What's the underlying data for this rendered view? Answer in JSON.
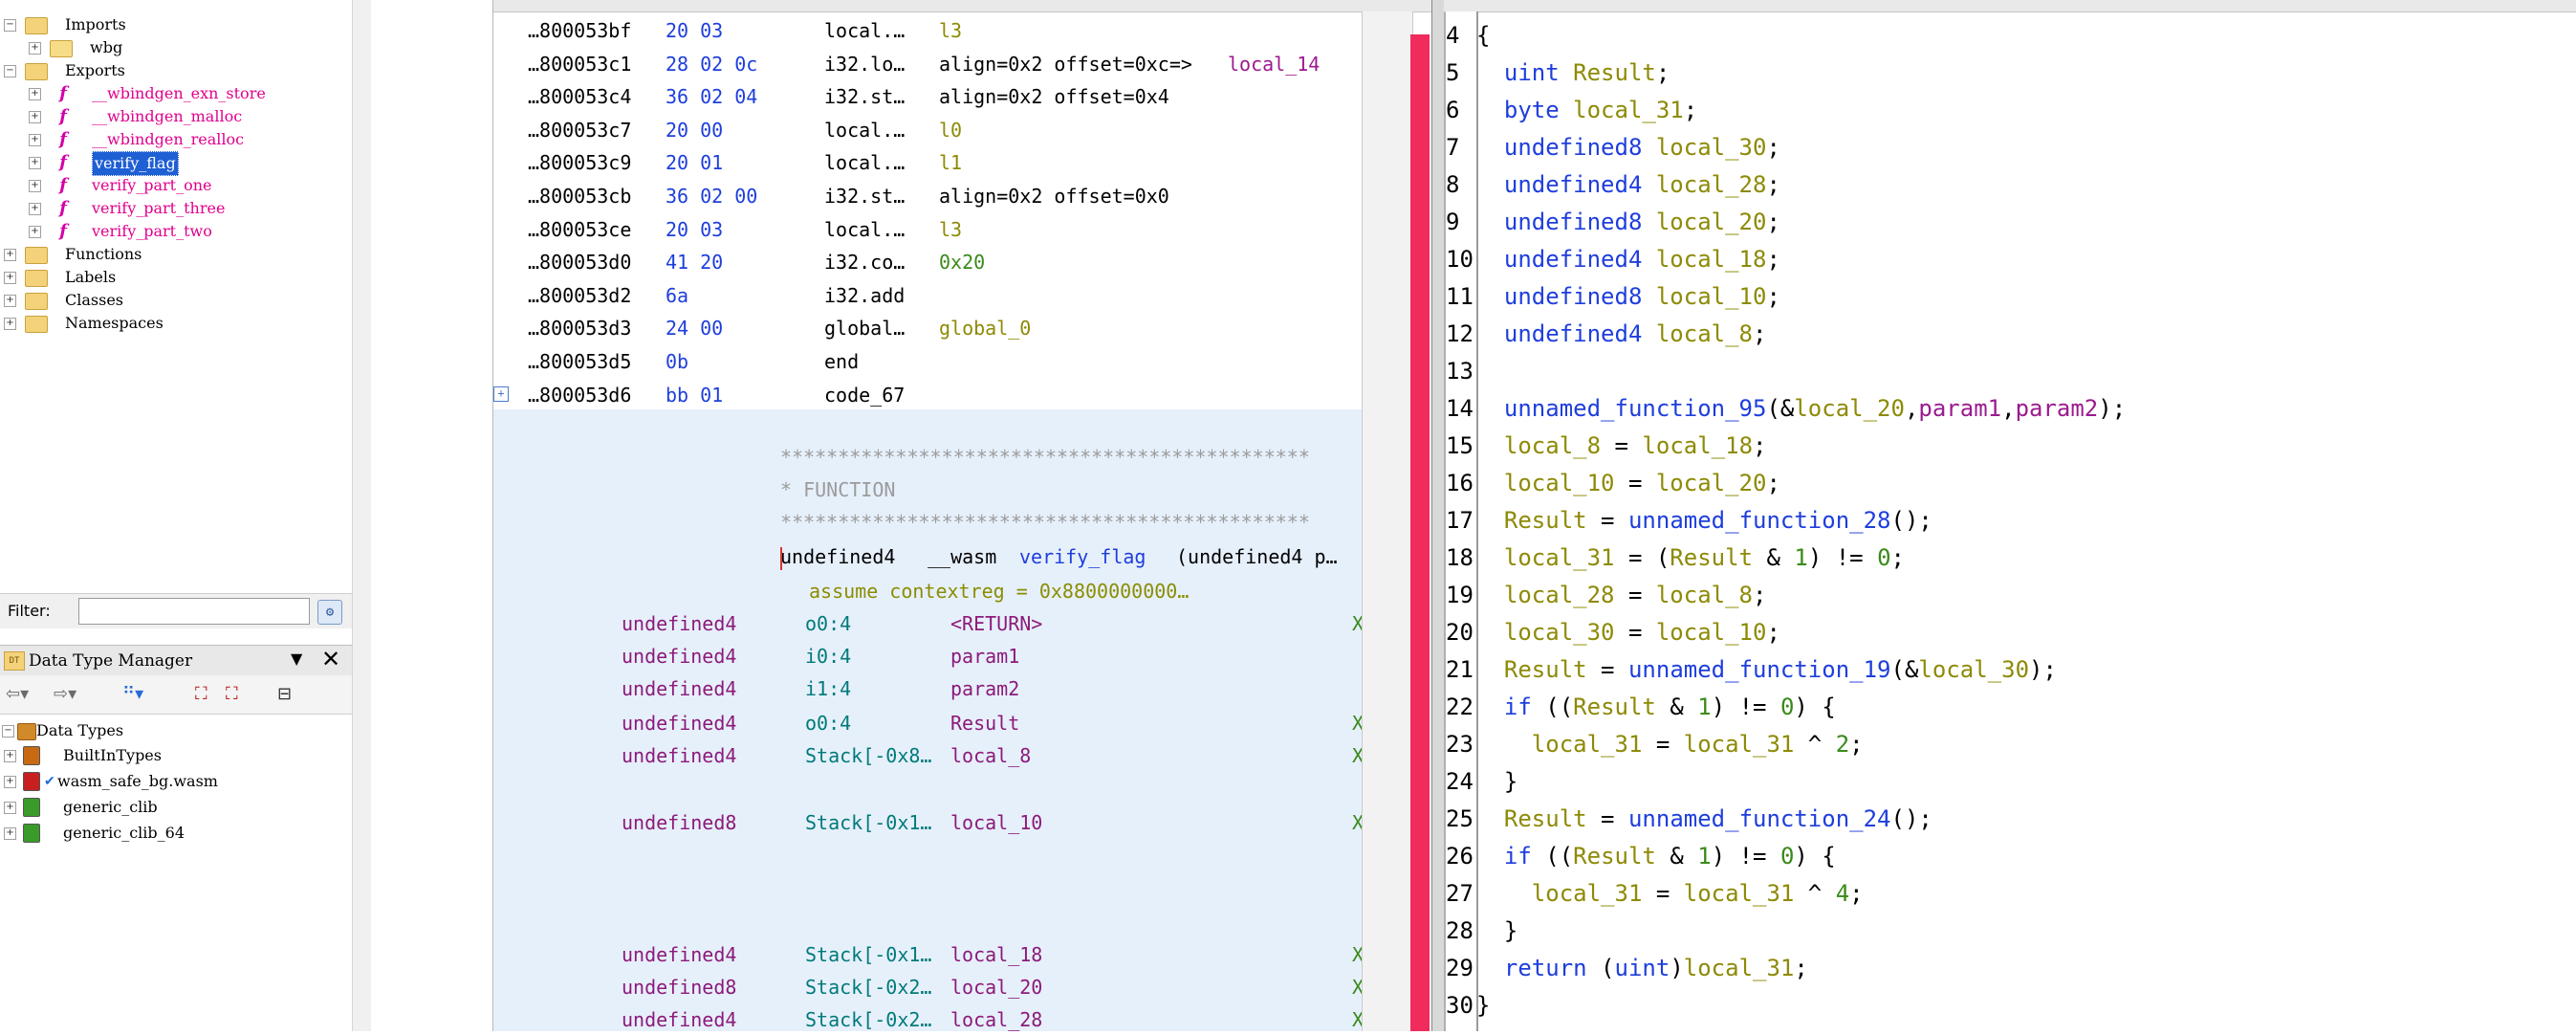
{
  "symbol_tree": {
    "items": [
      {
        "label": "Imports",
        "indent": 0,
        "icon": "folder-icon",
        "expanded": true
      },
      {
        "label": "wbg",
        "indent": 1,
        "icon": "package-icon"
      },
      {
        "label": "Exports",
        "indent": 0,
        "icon": "folder-icon",
        "expanded": true
      },
      {
        "label": "__wbindgen_exn_store",
        "indent": 1,
        "icon": "function-icon"
      },
      {
        "label": "__wbindgen_malloc",
        "indent": 1,
        "icon": "function-icon"
      },
      {
        "label": "__wbindgen_realloc",
        "indent": 1,
        "icon": "function-icon"
      },
      {
        "label": "verify_flag",
        "indent": 1,
        "icon": "function-icon",
        "selected": true
      },
      {
        "label": "verify_part_one",
        "indent": 1,
        "icon": "function-icon"
      },
      {
        "label": "verify_part_three",
        "indent": 1,
        "icon": "function-icon"
      },
      {
        "label": "verify_part_two",
        "indent": 1,
        "icon": "function-icon"
      },
      {
        "label": "Functions",
        "indent": 0,
        "icon": "folder-icon"
      },
      {
        "label": "Labels",
        "indent": 0,
        "icon": "folder-icon"
      },
      {
        "label": "Classes",
        "indent": 0,
        "icon": "folder-icon"
      },
      {
        "label": "Namespaces",
        "indent": 0,
        "icon": "folder-icon"
      }
    ],
    "filter_label": "Filter:",
    "filter_value": ""
  },
  "data_type_manager": {
    "title": "Data Type Manager",
    "root": "Data Types",
    "items": [
      "BuiltInTypes",
      "wasm_safe_bg.wasm",
      "generic_clib",
      "generic_clib_64"
    ]
  },
  "listing": {
    "rows": [
      {
        "addr": "…800053bf",
        "bytes": "20 03",
        "mnem": "local.…",
        "ops": "l3"
      },
      {
        "addr": "…800053c1",
        "bytes": "28 02 0c",
        "mnem": "i32.lo…",
        "ops": "align=0x2 offset=0xc=>",
        "ops_extra": "local_14"
      },
      {
        "addr": "…800053c4",
        "bytes": "36 02 04",
        "mnem": "i32.st…",
        "ops": "align=0x2 offset=0x4"
      },
      {
        "addr": "…800053c7",
        "bytes": "20 00",
        "mnem": "local.…",
        "ops": "l0"
      },
      {
        "addr": "…800053c9",
        "bytes": "20 01",
        "mnem": "local.…",
        "ops": "l1"
      },
      {
        "addr": "…800053cb",
        "bytes": "36 02 00",
        "mnem": "i32.st…",
        "ops": "align=0x2 offset=0x0"
      },
      {
        "addr": "…800053ce",
        "bytes": "20 03",
        "mnem": "local.…",
        "ops": "l3"
      },
      {
        "addr": "…800053d0",
        "bytes": "41 20",
        "mnem": "i32.co…",
        "ops": "0x20"
      },
      {
        "addr": "…800053d2",
        "bytes": "6a",
        "mnem": "i32.add",
        "ops": ""
      },
      {
        "addr": "…800053d3",
        "bytes": "24 00",
        "mnem": "global…",
        "ops": "global_0"
      },
      {
        "addr": "…800053d5",
        "bytes": "0b",
        "mnem": "end",
        "ops": ""
      },
      {
        "addr": "…800053d6",
        "bytes": "bb 01",
        "mnem": "code_67",
        "ops": ""
      }
    ],
    "stars": "**********************************************",
    "function_banner": "*                    FUNCTION",
    "signature": {
      "ret": "undefined4",
      "conv": "__wasm",
      "name": "verify_flag",
      "args": "(undefined4 p…"
    },
    "assume": "assume contextreg = 0x8800000000…",
    "vars": [
      {
        "type": "undefined4",
        "loc": "o0:4",
        "name": "<RETURN>"
      },
      {
        "type": "undefined4",
        "loc": "i0:4",
        "name": "param1"
      },
      {
        "type": "undefined4",
        "loc": "i1:4",
        "name": "param2"
      },
      {
        "type": "undefined4",
        "loc": "o0:4",
        "name": "Result"
      },
      {
        "type": "undefined4",
        "loc": "Stack[-0x8…",
        "name": "local_8"
      },
      {
        "type": "undefined8",
        "loc": "Stack[-0x1…",
        "name": "local_10"
      },
      {
        "type": "undefined4",
        "loc": "Stack[-0x1…",
        "name": "local_18"
      },
      {
        "type": "undefined8",
        "loc": "Stack[-0x2…",
        "name": "local_20"
      },
      {
        "type": "undefined4",
        "loc": "Stack[-0x2…",
        "name": "local_28"
      }
    ],
    "xref_mark": "X"
  },
  "decompiler": {
    "lines": [
      {
        "n": "4",
        "code": "{"
      },
      {
        "n": "5",
        "code": "  uint Result;"
      },
      {
        "n": "6",
        "code": "  byte local_31;"
      },
      {
        "n": "7",
        "code": "  undefined8 local_30;"
      },
      {
        "n": "8",
        "code": "  undefined4 local_28;"
      },
      {
        "n": "9",
        "code": "  undefined8 local_20;"
      },
      {
        "n": "10",
        "code": "  undefined4 local_18;"
      },
      {
        "n": "11",
        "code": "  undefined8 local_10;"
      },
      {
        "n": "12",
        "code": "  undefined4 local_8;"
      },
      {
        "n": "13",
        "code": ""
      },
      {
        "n": "14",
        "code": "  unnamed_function_95(&local_20,param1,param2);"
      },
      {
        "n": "15",
        "code": "  local_8 = local_18;"
      },
      {
        "n": "16",
        "code": "  local_10 = local_20;"
      },
      {
        "n": "17",
        "code": "  Result = unnamed_function_28();"
      },
      {
        "n": "18",
        "code": "  local_31 = (Result & 1) != 0;"
      },
      {
        "n": "19",
        "code": "  local_28 = local_8;"
      },
      {
        "n": "20",
        "code": "  local_30 = local_10;"
      },
      {
        "n": "21",
        "code": "  Result = unnamed_function_19(&local_30);"
      },
      {
        "n": "22",
        "code": "  if ((Result & 1) != 0) {"
      },
      {
        "n": "23",
        "code": "    local_31 = local_31 ^ 2;"
      },
      {
        "n": "24",
        "code": "  }"
      },
      {
        "n": "25",
        "code": "  Result = unnamed_function_24();"
      },
      {
        "n": "26",
        "code": "  if ((Result & 1) != 0) {"
      },
      {
        "n": "27",
        "code": "    local_31 = local_31 ^ 4;"
      },
      {
        "n": "28",
        "code": "  }"
      },
      {
        "n": "29",
        "code": "  return (uint)local_31;"
      },
      {
        "n": "30",
        "code": "}"
      }
    ]
  },
  "colors": {
    "accent_red": "#f12b5c",
    "selection": "#1f5fd4",
    "func_bg": "#e6f0fb"
  }
}
